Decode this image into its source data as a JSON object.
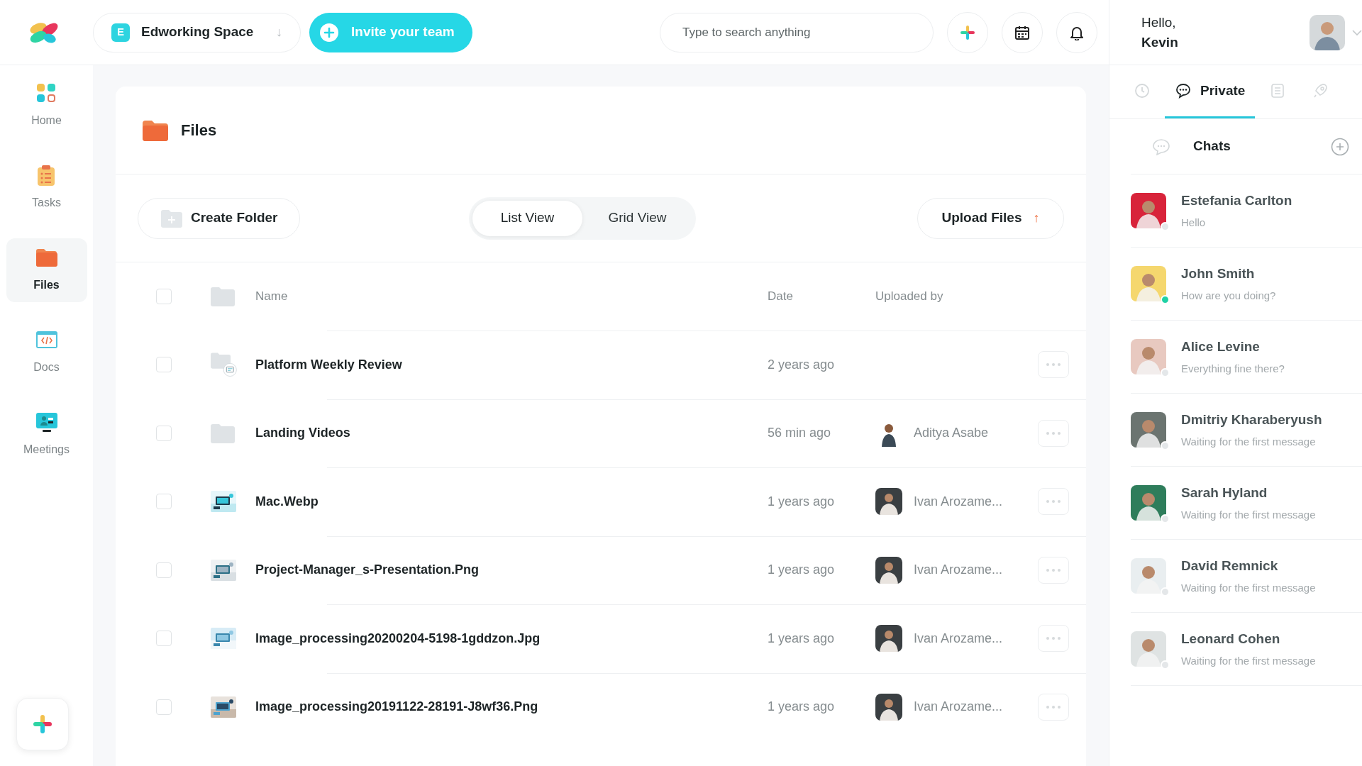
{
  "topbar": {
    "workspace": {
      "badge": "E",
      "name": "Edworking Space",
      "arrow": "↓"
    },
    "invite_button": "Invite your team",
    "search": {
      "placeholder": "Type to search anything"
    }
  },
  "user": {
    "greeting": "Hello,",
    "name": "Kevin"
  },
  "sidebar": {
    "items": [
      {
        "kind": "home",
        "label": "Home",
        "selected": false
      },
      {
        "kind": "tasks",
        "label": "Tasks",
        "selected": false
      },
      {
        "kind": "files",
        "label": "Files",
        "selected": true
      },
      {
        "kind": "docs",
        "label": "Docs",
        "selected": false
      },
      {
        "kind": "meetings",
        "label": "Meetings",
        "selected": false
      }
    ]
  },
  "page": {
    "title": "Files",
    "toolbar": {
      "create_folder": "Create Folder",
      "views": [
        {
          "label": "List View",
          "selected": true
        },
        {
          "label": "Grid View",
          "selected": false
        }
      ],
      "upload": "Upload Files",
      "upload_arrow": "↑"
    },
    "table": {
      "columns": [
        "Name",
        "Date",
        "Uploaded by"
      ],
      "header_checked": false,
      "rows": [
        {
          "kind": "shared-folder",
          "name": "Platform Weekly Review",
          "date": "2 years ago",
          "checked": false
        },
        {
          "kind": "folder",
          "name": "Landing Videos",
          "date": "56 min ago",
          "uploaded_by": "Aditya Asabe",
          "checked": false
        },
        {
          "name": "Mac.Webp",
          "date": "1 years ago",
          "uploaded_by": "Ivan Arozame...",
          "checked": false
        },
        {
          "name": "Project-Manager_s-Presentation.Png",
          "date": "1 years ago",
          "uploaded_by": "Ivan Arozame...",
          "checked": false
        },
        {
          "name": "Image_processing20200204-5198-1gddzon.Jpg",
          "date": "1 years ago",
          "uploaded_by": "Ivan Arozame...",
          "checked": false
        },
        {
          "name": "Image_processing20191122-28191-J8wf36.Png",
          "date": "1 years ago",
          "uploaded_by": "Ivan Arozame...",
          "checked": false
        }
      ]
    }
  },
  "right_panel": {
    "tabs": [
      {
        "kind": "history",
        "selected": false
      },
      {
        "kind": "private",
        "label": "Private",
        "selected": true
      },
      {
        "kind": "list",
        "selected": false
      },
      {
        "kind": "rocket",
        "selected": false
      }
    ],
    "chats_title": "Chats",
    "chats": [
      {
        "name": "Estefania Carlton",
        "message": "Hello",
        "online": false,
        "color": "#d8233a"
      },
      {
        "name": "John Smith",
        "message": "How are you doing?",
        "online": true,
        "color": "#f5d76e"
      },
      {
        "name": "Alice Levine",
        "message": "Everything fine there?",
        "online": false,
        "color": "#e8c9c0"
      },
      {
        "name": "Dmitriy Kharaberyush",
        "message": "Waiting for the first message",
        "online": false,
        "color": "#6b7470"
      },
      {
        "name": "Sarah Hyland",
        "message": "Waiting for the first message",
        "online": false,
        "color": "#2e7d5b"
      },
      {
        "name": "David Remnick",
        "message": "Waiting for the first message",
        "online": false,
        "color": "#e9eef0"
      },
      {
        "name": "Leonard Cohen",
        "message": "Waiting for the first message",
        "online": false,
        "color": "#dfe3e3"
      }
    ]
  }
}
